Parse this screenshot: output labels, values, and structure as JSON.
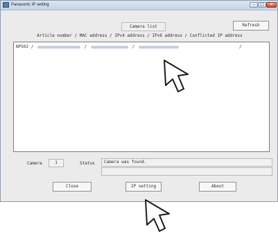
{
  "window": {
    "title": "Panasonic IP setting",
    "min_glyph": "–",
    "max_glyph": "□",
    "close_glyph": "✕"
  },
  "toolbar": {
    "refresh_label": "Refresh",
    "camera_list_label": "Camera list"
  },
  "list": {
    "header": "Article number / MAC address / IPv4 address / IPv6 address / Conflicted IP address",
    "rows": [
      {
        "model": "NP502",
        "separator": "/",
        "end_mark": "/"
      }
    ]
  },
  "status": {
    "camera_label": "Camera",
    "camera_count": "1",
    "status_label": "Status",
    "message": "Camera was found.",
    "message2": ""
  },
  "buttons": {
    "close_label": "Close",
    "ip_setting_label": "IP setting",
    "about_label": "About"
  },
  "colors": {
    "window_bg": "#ebebeb",
    "title_gradient_top": "#dbe6f2",
    "close_button": "#c8482c"
  }
}
